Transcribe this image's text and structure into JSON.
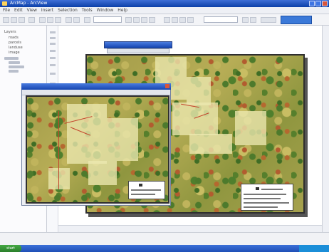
{
  "window": {
    "title": "ArcMap - ArcView"
  },
  "menu": {
    "items": [
      "File",
      "Edit",
      "View",
      "Insert",
      "Selection",
      "Tools",
      "Window",
      "Help"
    ]
  },
  "toc": {
    "labels": [
      "Layers",
      "roads",
      "parcels",
      "landuse",
      "image"
    ]
  },
  "statusbar": {
    "coords": ""
  },
  "taskbar": {
    "start_label": "start",
    "clock": ""
  }
}
